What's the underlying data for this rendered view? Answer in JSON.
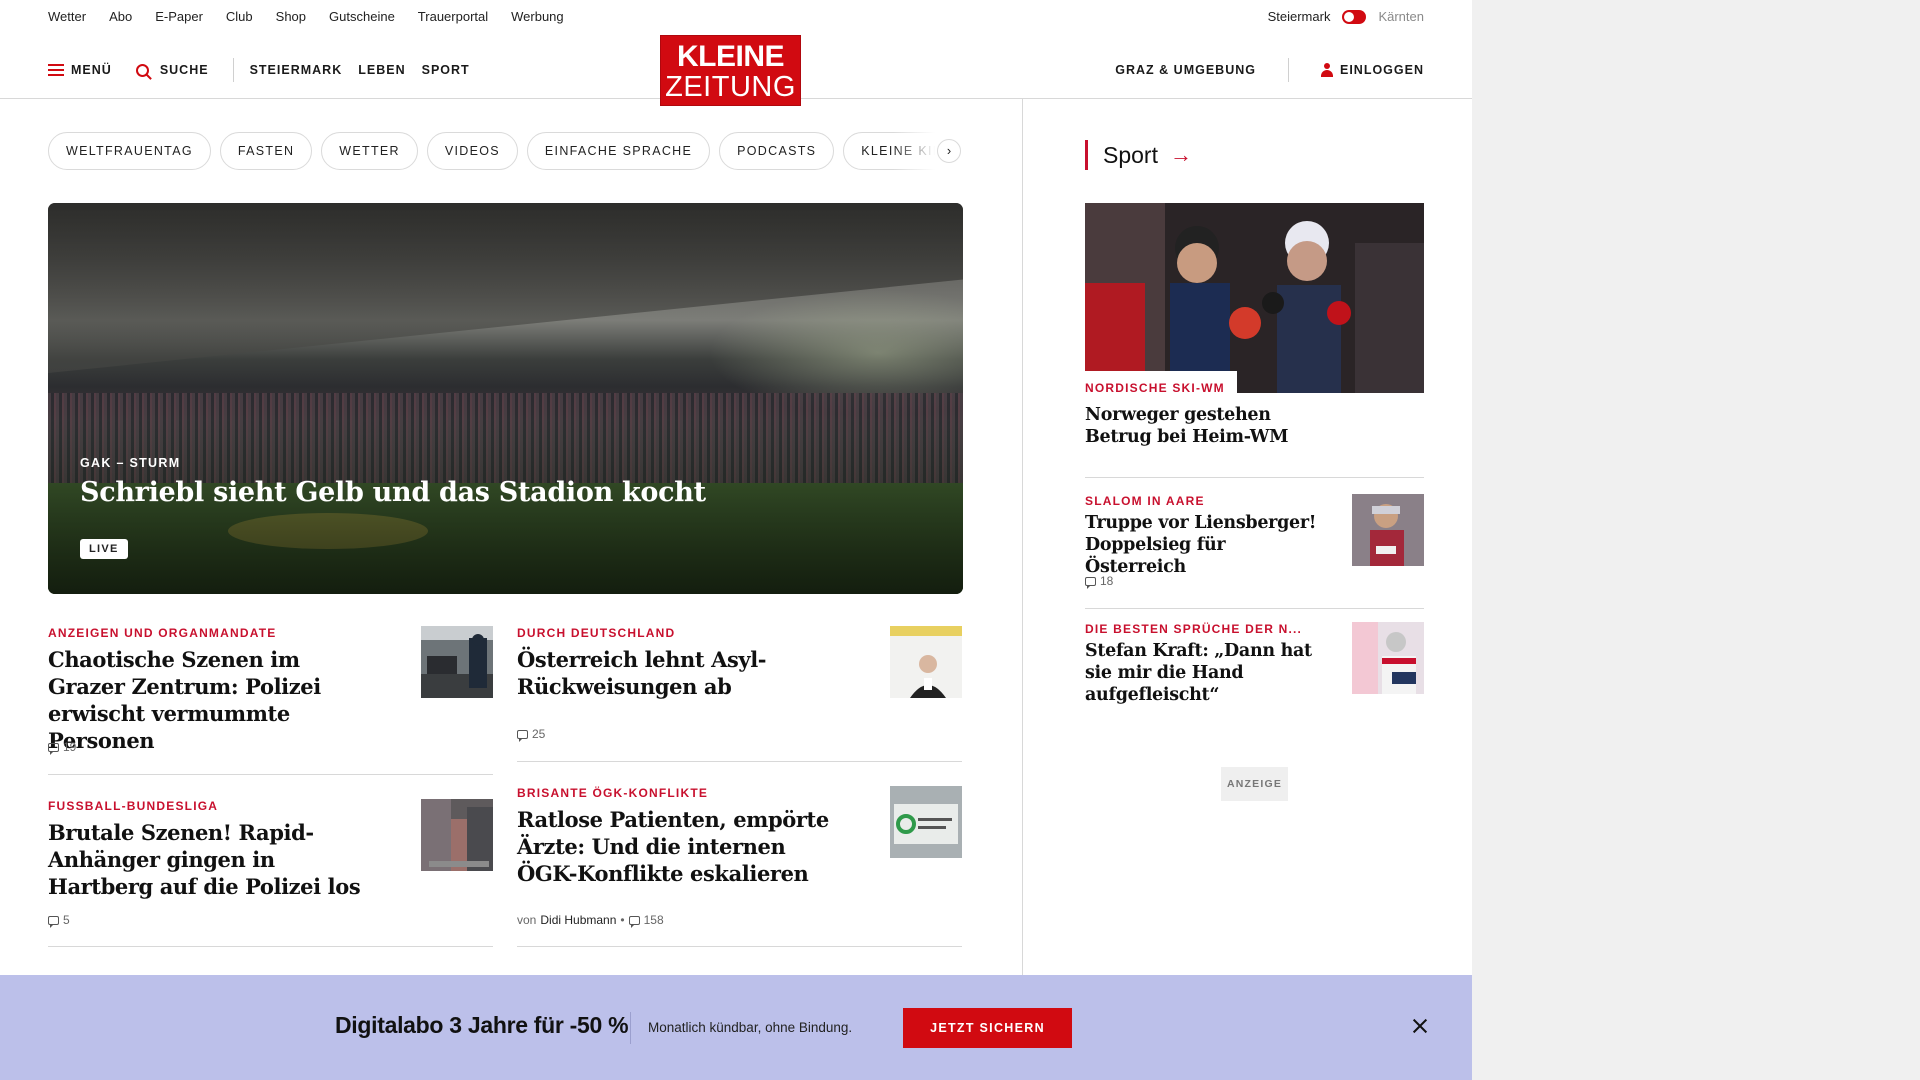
{
  "utility": {
    "links": [
      "Wetter",
      "Abo",
      "E-Paper",
      "Club",
      "Shop",
      "Gutscheine",
      "Trauerportal",
      "Werbung"
    ],
    "region_active": "Steiermark",
    "region_inactive": "Kärnten"
  },
  "header": {
    "menu_label": "MENÜ",
    "search_label": "SUCHE",
    "nav": [
      "STEIERMARK",
      "LEBEN",
      "SPORT"
    ],
    "logo_line1": "KLEINE",
    "logo_line2": "ZEITUNG",
    "region_link": "GRAZ & UMGEBUNG",
    "login_label": "EINLOGGEN"
  },
  "pills": [
    "WELTFRAUENTAG",
    "FASTEN",
    "WETTER",
    "VIDEOS",
    "EINFACHE SPRACHE",
    "PODCASTS",
    "KLEINE KINDERZEITUNG"
  ],
  "pill_next": "›",
  "hero": {
    "kicker": "GAK – STURM",
    "title": "Schriebl sieht Gelb und das Stadion kocht",
    "badge": "LIVE"
  },
  "articles": [
    {
      "kicker": "ANZEIGEN UND ORGANMANDATE",
      "title": "Chaotische Szenen im Grazer Zentrum: Polizei erwischt vermummte Personen",
      "comments": "19"
    },
    {
      "kicker": "DURCH DEUTSCHLAND",
      "title": "Österreich lehnt Asyl-Rückweisungen ab",
      "comments": "25"
    },
    {
      "kicker": "FUSSBALL-BUNDESLIGA",
      "title": "Brutale Szenen! Rapid-Anhänger gingen in Hartberg auf die Polizei los",
      "comments": "5"
    },
    {
      "kicker": "BRISANTE ÖGK-KONFLIKTE",
      "title": "Ratlose Patienten, empörte Ärzte: Und die internen ÖGK-Konflikte eskalieren",
      "author_prefix": "von",
      "author": "Didi Hubmann",
      "dot": "•",
      "comments": "158"
    }
  ],
  "sidebar": {
    "section_title": "Sport",
    "arrow": "→",
    "top": {
      "kicker": "NORDISCHE SKI-WM",
      "title": "Norweger gestehen Betrug bei Heim-WM"
    },
    "items": [
      {
        "kicker": "SLALOM IN AARE",
        "title": "Truppe vor Liensberger! Doppelsieg für Österreich",
        "comments": "18"
      },
      {
        "kicker": "DIE BESTEN SPRÜCHE DER N...",
        "title": "Stefan Kraft: „Dann hat sie mir die Hand aufgefleischt“"
      }
    ],
    "ad_label": "ANZEIGE"
  },
  "promo": {
    "headline": "Digitalabo 3 Jahre für -50 %",
    "subtext": "Monatlich kündbar, ohne Bindung.",
    "cta": "JETZT SICHERN"
  },
  "colors": {
    "brand_red": "#d10a11",
    "kicker_red": "#c8102e",
    "promo_bg": "#bcc0ea"
  }
}
